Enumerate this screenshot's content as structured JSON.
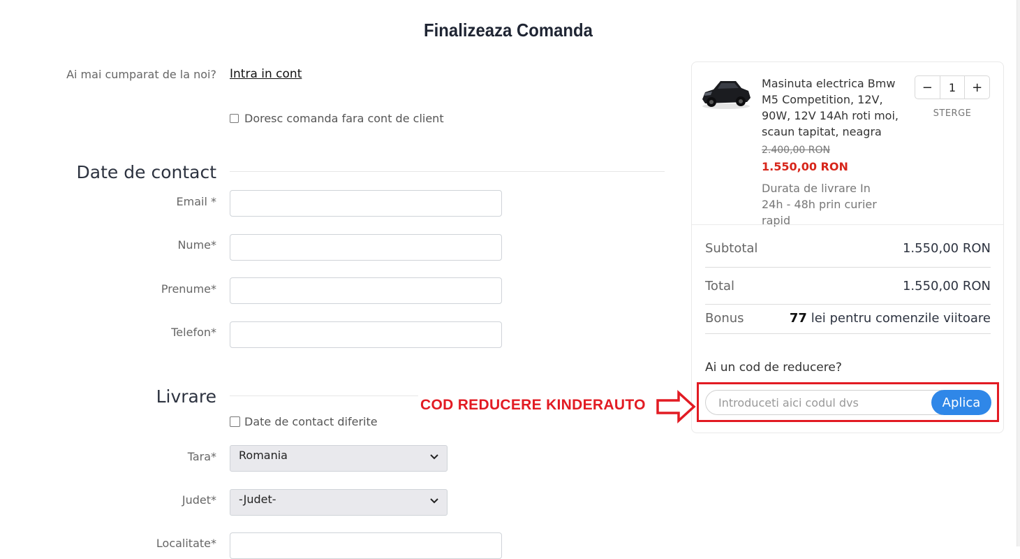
{
  "page": {
    "title": "Finalizeaza Comanda"
  },
  "account": {
    "question": "Ai mai cumparat de la noi?",
    "login_link": "Intra in cont",
    "guest_checkbox_label": "Doresc comanda fara cont de client"
  },
  "contact": {
    "section_title": "Date de contact",
    "fields": [
      {
        "label": "Email *"
      },
      {
        "label": "Nume*"
      },
      {
        "label": "Prenume*"
      },
      {
        "label": "Telefon*"
      }
    ]
  },
  "delivery": {
    "section_title": "Livrare",
    "different_contact_label": "Date de contact diferite",
    "country_label": "Tara*",
    "country_value": "Romania",
    "county_label": "Judet*",
    "county_value": "-Judet-",
    "city_label": "Localitate*"
  },
  "cart": {
    "product": {
      "name": "Masinuta electrica Bmw M5 Competition, 12V, 90W, 12V 14Ah roti moi, scaun tapitat, neagra",
      "old_price": "2.400,00 RON",
      "price": "1.550,00 RON",
      "delivery_info": "Durata de livrare In 24h - 48h prin curier rapid",
      "quantity": "1",
      "minus_label": "−",
      "plus_label": "+",
      "remove_label": "STERGE",
      "image_icon": "toy-car-icon"
    },
    "subtotal_label": "Subtotal",
    "subtotal_value": "1.550,00 RON",
    "total_label": "Total",
    "total_value": "1.550,00 RON",
    "bonus_label": "Bonus",
    "bonus_amount": "77",
    "bonus_text": " lei pentru comenzile viitoare"
  },
  "coupon": {
    "question": "Ai un cod de reducere?",
    "placeholder": "Introduceti aici codul dvs",
    "apply_label": "Aplica"
  },
  "annotation": {
    "text": "COD REDUCERE KINDERAUTO",
    "color": "#e21b23",
    "arrow_icon": "right-arrow-icon"
  }
}
